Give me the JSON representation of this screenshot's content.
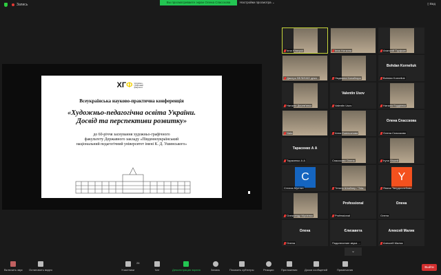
{
  "topbar": {
    "record": "Запись",
    "viewing": "Вы просматриваете экран Олена Спасскова",
    "view_options": "Настройки просмотра",
    "view": "Вид"
  },
  "slide": {
    "logo": "ХГФ",
    "logo_text": "художньо-графічний факультет",
    "conference": "Всеукраїнська науково-практична конференція",
    "title_line1": "«Художньо-педагогічна освіта України.",
    "title_line2": "Досвід та перспективи розвитку»",
    "sub_line1": "до 60-річчя заснування художньо-графічного",
    "sub_line2": "факультету Державного закладу «Південноукраїнський",
    "sub_line3": "національний педагогічний університет імені К. Д. Ушинського»"
  },
  "participants": [
    {
      "name": "Inna Khavyuk",
      "type": "video",
      "active": true,
      "muted": true
    },
    {
      "name": "Інна Ноткина",
      "type": "video",
      "muted": true
    },
    {
      "name": "Анатолій Труфкин",
      "type": "video",
      "muted": true
    },
    {
      "name": "Дмитро ВЕЛИЧКО дека...",
      "type": "video",
      "muted": true
    },
    {
      "name": "Людмила Копайгора",
      "type": "video",
      "muted": true
    },
    {
      "name": "Bohdan Korneliuk",
      "type": "name",
      "muted": true
    },
    {
      "name": "Наталія Дерев'янко",
      "type": "video",
      "muted": true
    },
    {
      "name": "Valentin Usov",
      "type": "name",
      "muted": true
    },
    {
      "name": "Наталія Гордієнко",
      "type": "video",
      "muted": true
    },
    {
      "name": "Nata",
      "type": "video",
      "muted": true
    },
    {
      "name": "Анна Емельянова",
      "type": "video",
      "muted": true
    },
    {
      "name": "Олена Спасскова",
      "type": "name",
      "muted": true
    },
    {
      "name": "Тарасенко А А",
      "type": "name",
      "muted": true
    },
    {
      "name": "Спасскова Олена",
      "type": "video",
      "muted": false
    },
    {
      "name": "Iryna Shumil",
      "type": "video",
      "muted": true
    },
    {
      "name": "Стелла Мунтян",
      "type": "avatar",
      "letter": "C",
      "color": "#1565c0",
      "muted": false
    },
    {
      "name": "Тетяна Штайнер / Teta...",
      "type": "video",
      "muted": true
    },
    {
      "name": "Янина Твердохлебова",
      "type": "avatar",
      "letter": "Y",
      "color": "#f4511e",
      "muted": true
    },
    {
      "name": "Олександр Мусієнко",
      "type": "video",
      "muted": true
    },
    {
      "name": "Professional",
      "type": "name",
      "muted": true
    },
    {
      "name": "Олена",
      "type": "name",
      "muted": false
    },
    {
      "name": "Олена",
      "type": "name",
      "muted": true
    },
    {
      "name": "Єлизавета",
      "type": "name",
      "muted": false,
      "label": "Подключение звука ..."
    },
    {
      "name": "Алексей Малик",
      "type": "name",
      "muted": true
    }
  ],
  "toolbar": {
    "unmute": "Включить звук",
    "stop_video": "Остановить видео",
    "participants": "Участники",
    "participants_count": "26",
    "chat": "Чат",
    "share": "Демонстрация экрана",
    "record": "Запись",
    "captions": "Показать субтитры",
    "reactions": "Реакции",
    "apps": "Приложения",
    "whiteboard": "Доски сообщений",
    "notes": "Примечания",
    "leave": "Выйти"
  }
}
